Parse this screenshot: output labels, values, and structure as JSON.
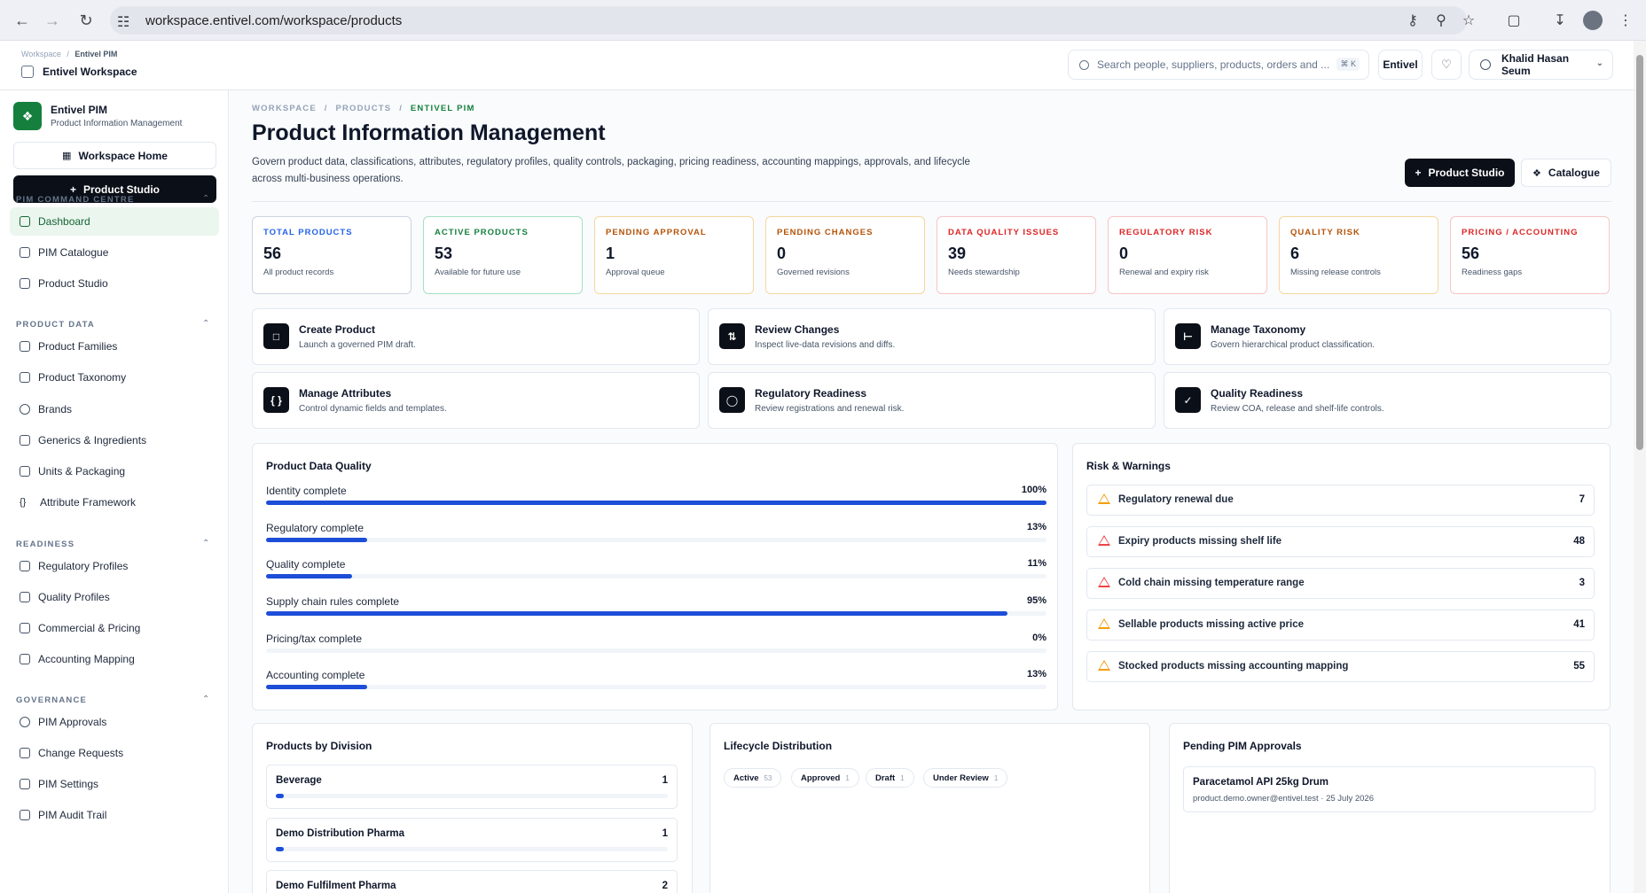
{
  "browser": {
    "url": "workspace.entivel.com/workspace/products"
  },
  "topbar": {
    "crumb_root": "Workspace",
    "crumb_current": "Entivel PIM",
    "workspace_name": "Entivel Workspace",
    "search_placeholder": "Search people, suppliers, products, orders and ...",
    "search_shortcut": "⌘ K",
    "org_label": "Entivel",
    "user_name": "Khalid Hasan Seum"
  },
  "sidebar": {
    "app_name": "Entivel PIM",
    "app_sub": "Product Information Management",
    "workspace_home": "Workspace Home",
    "product_studio": "Product Studio",
    "sections": [
      {
        "title": "PIM COMMAND CENTRE",
        "items": [
          "Dashboard",
          "PIM Catalogue",
          "Product Studio"
        ]
      },
      {
        "title": "PRODUCT DATA",
        "items": [
          "Product Families",
          "Product Taxonomy",
          "Brands",
          "Generics & Ingredients",
          "Units & Packaging",
          "Attribute Framework"
        ]
      },
      {
        "title": "READINESS",
        "items": [
          "Regulatory Profiles",
          "Quality Profiles",
          "Commercial & Pricing",
          "Accounting Mapping"
        ]
      },
      {
        "title": "GOVERNANCE",
        "items": [
          "PIM Approvals",
          "Change Requests",
          "PIM Settings",
          "PIM Audit Trail"
        ]
      }
    ]
  },
  "header": {
    "crumb_1": "WORKSPACE",
    "crumb_2": "PRODUCTS",
    "crumb_3": "ENTIVEL PIM",
    "title": "Product Information Management",
    "description": "Govern product data, classifications, attributes, regulatory profiles, quality controls, packaging, pricing readiness, accounting mappings, approvals, and lifecycle across multi-business operations.",
    "btn_studio": "Product Studio",
    "btn_catalogue": "Catalogue"
  },
  "stats": [
    {
      "label": "TOTAL PRODUCTS",
      "value": "56",
      "sub": "All product records",
      "color": "#2563eb",
      "border": "#cbd5e1"
    },
    {
      "label": "ACTIVE PRODUCTS",
      "value": "53",
      "sub": "Available for future use",
      "color": "#15803d",
      "border": "#a7e0c4"
    },
    {
      "label": "PENDING APPROVAL",
      "value": "1",
      "sub": "Approval queue",
      "color": "#b45309",
      "border": "#f5d79e"
    },
    {
      "label": "PENDING CHANGES",
      "value": "0",
      "sub": "Governed revisions",
      "color": "#b45309",
      "border": "#f5d79e"
    },
    {
      "label": "DATA QUALITY ISSUES",
      "value": "39",
      "sub": "Needs stewardship",
      "color": "#dc2626",
      "border": "#f7c6c6"
    },
    {
      "label": "REGULATORY RISK",
      "value": "0",
      "sub": "Renewal and expiry risk",
      "color": "#dc2626",
      "border": "#f7c6c6"
    },
    {
      "label": "QUALITY RISK",
      "value": "6",
      "sub": "Missing release controls",
      "color": "#b45309",
      "border": "#f5d79e"
    },
    {
      "label": "PRICING / ACCOUNTING",
      "value": "56",
      "sub": "Readiness gaps",
      "color": "#dc2626",
      "border": "#f7c6c6"
    }
  ],
  "quick_actions": [
    {
      "title": "Create Product",
      "sub": "Launch a governed PIM draft.",
      "icon": "document-icon"
    },
    {
      "title": "Review Changes",
      "sub": "Inspect live-data revisions and diffs.",
      "icon": "diff-icon"
    },
    {
      "title": "Manage Taxonomy",
      "sub": "Govern hierarchical product classification.",
      "icon": "tree-icon"
    },
    {
      "title": "Manage Attributes",
      "sub": "Control dynamic fields and templates.",
      "icon": "braces-icon"
    },
    {
      "title": "Regulatory Readiness",
      "sub": "Review registrations and renewal risk.",
      "icon": "shield-icon"
    },
    {
      "title": "Quality Readiness",
      "sub": "Review COA, release and shelf-life controls.",
      "icon": "clipboard-icon"
    }
  ],
  "data_quality": {
    "title": "Product Data Quality",
    "rows": [
      {
        "label": "Identity complete",
        "value": "100%",
        "pct": 100
      },
      {
        "label": "Regulatory complete",
        "value": "13%",
        "pct": 13
      },
      {
        "label": "Quality complete",
        "value": "11%",
        "pct": 11
      },
      {
        "label": "Supply chain rules complete",
        "value": "95%",
        "pct": 95
      },
      {
        "label": "Pricing/tax complete",
        "value": "0%",
        "pct": 0
      },
      {
        "label": "Accounting complete",
        "value": "13%",
        "pct": 13
      }
    ]
  },
  "risks": {
    "title": "Risk & Warnings",
    "rows": [
      {
        "label": "Regulatory renewal due",
        "count": "7",
        "severity": "warning"
      },
      {
        "label": "Expiry products missing shelf life",
        "count": "48",
        "severity": "danger"
      },
      {
        "label": "Cold chain missing temperature range",
        "count": "3",
        "severity": "danger"
      },
      {
        "label": "Sellable products missing active price",
        "count": "41",
        "severity": "warning"
      },
      {
        "label": "Stocked products missing accounting mapping",
        "count": "55",
        "severity": "warning"
      }
    ]
  },
  "divisions": {
    "title": "Products by Division",
    "rows": [
      {
        "label": "Beverage",
        "count": "1",
        "pct": 2
      },
      {
        "label": "Demo Distribution Pharma",
        "count": "1",
        "pct": 2
      },
      {
        "label": "Demo Fulfilment Pharma",
        "count": "2",
        "pct": 4
      }
    ]
  },
  "lifecycle": {
    "title": "Lifecycle Distribution",
    "chips": [
      {
        "label": "Active",
        "count": "53"
      },
      {
        "label": "Approved",
        "count": "1"
      },
      {
        "label": "Draft",
        "count": "1"
      },
      {
        "label": "Under Review",
        "count": "1"
      }
    ]
  },
  "approvals": {
    "title": "Pending PIM Approvals",
    "items": [
      {
        "title": "Paracetamol API 25kg Drum",
        "sub": "product.demo.owner@entivel.test · 25 July 2026"
      }
    ]
  }
}
